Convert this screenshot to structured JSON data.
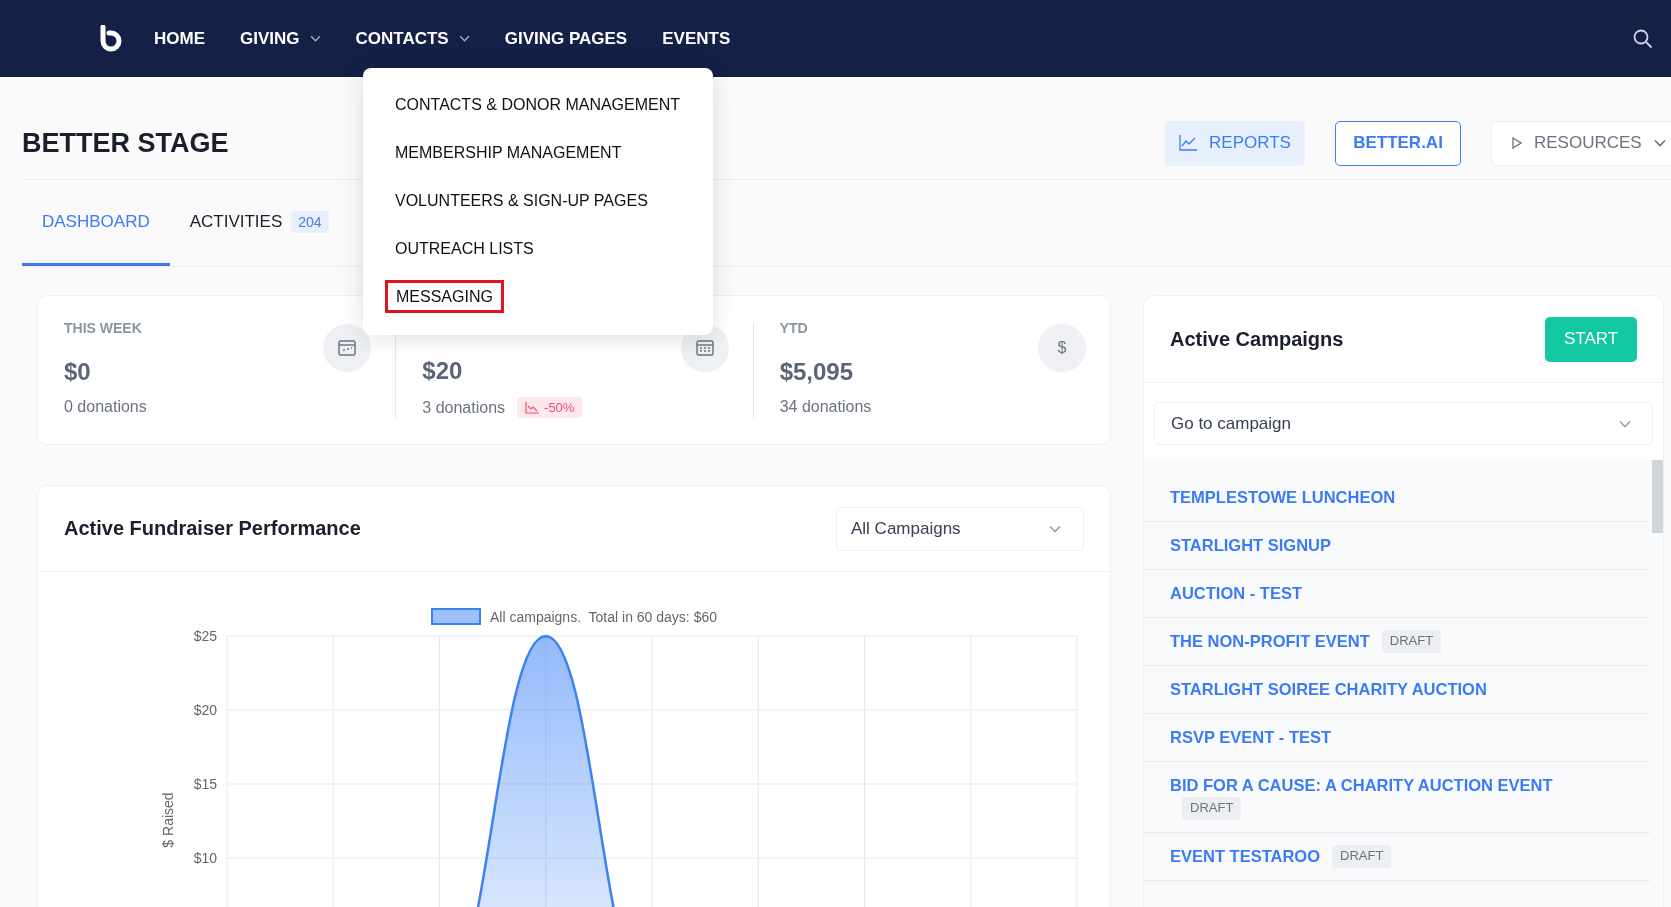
{
  "nav": {
    "items": [
      {
        "label": "HOME",
        "dropdown": false
      },
      {
        "label": "GIVING",
        "dropdown": true
      },
      {
        "label": "CONTACTS",
        "dropdown": true
      },
      {
        "label": "GIVING PAGES",
        "dropdown": false
      },
      {
        "label": "EVENTS",
        "dropdown": false
      }
    ]
  },
  "contacts_menu": {
    "items": [
      {
        "label": "CONTACTS & DONOR MANAGEMENT",
        "outlined": false
      },
      {
        "label": "MEMBERSHIP MANAGEMENT",
        "outlined": false
      },
      {
        "label": "VOLUNTEERS & SIGN-UP PAGES",
        "outlined": false
      },
      {
        "label": "OUTREACH LISTS",
        "outlined": false
      },
      {
        "label": "MESSAGING",
        "outlined": true
      }
    ]
  },
  "page": {
    "title": "BETTER STAGE",
    "actions": [
      {
        "kind": "reports",
        "label": "REPORTS"
      },
      {
        "kind": "ai",
        "label": "BETTER.AI"
      },
      {
        "kind": "resources",
        "label": "RESOURCES"
      }
    ]
  },
  "tabs": [
    {
      "label": "DASHBOARD",
      "selected": true
    },
    {
      "label": "ACTIVITIES",
      "selected": false,
      "count": "204"
    }
  ],
  "stats": [
    {
      "label": "THIS WEEK",
      "amount": "$0",
      "donations": "0 donations"
    },
    {
      "amount": "$20",
      "donations": "3 donations",
      "trend": "-50%"
    },
    {
      "label": "YTD",
      "amount": "$5,095",
      "donations": "34 donations",
      "icon_text": "$"
    }
  ],
  "performance": {
    "title": "Active Fundraiser Performance",
    "filter": "All Campaigns",
    "chart_data": {
      "type": "area",
      "ylabel": "$ Raised",
      "grid": true,
      "ylim": [
        0,
        25
      ],
      "yticks": [
        {
          "value": 10,
          "label": "$10"
        },
        {
          "value": 15,
          "label": "$15"
        },
        {
          "value": 20,
          "label": "$20"
        },
        {
          "value": 25,
          "label": "$25"
        }
      ],
      "series": [
        {
          "name": "All campaigns.  Total in 60 days: $60",
          "color": "#3b82f6",
          "values": [
            0,
            0,
            0,
            25,
            0,
            0,
            0,
            0,
            0
          ]
        }
      ]
    }
  },
  "campaigns": {
    "title": "Active Campaigns",
    "start": "START",
    "placeholder": "Go to campaign",
    "items": [
      {
        "name": "TEMPLESTOWE LUNCHEON"
      },
      {
        "name": "STARLIGHT SIGNUP"
      },
      {
        "name": "AUCTION - TEST"
      },
      {
        "name": "THE NON-PROFIT EVENT",
        "badge": "DRAFT"
      },
      {
        "name": "STARLIGHT SOIREE CHARITY AUCTION"
      },
      {
        "name": "RSVP EVENT - TEST"
      },
      {
        "name": "BID FOR A CAUSE: A CHARITY AUCTION EVENT",
        "badge": "DRAFT"
      },
      {
        "name": "EVENT TESTAROO",
        "badge": "DRAFT"
      }
    ]
  }
}
